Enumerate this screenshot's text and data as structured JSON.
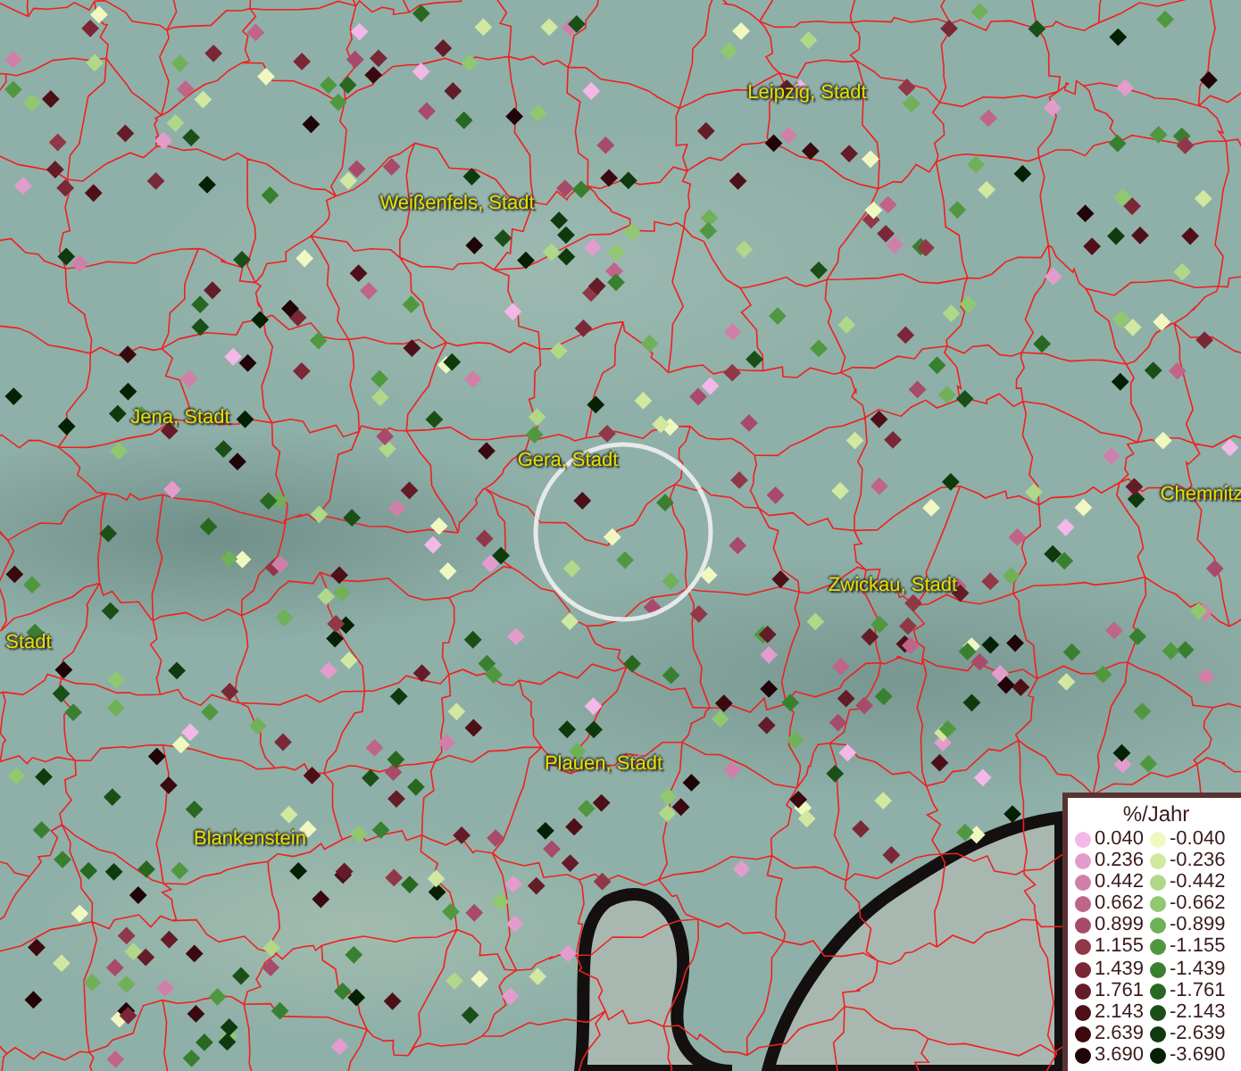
{
  "map_labels": [
    {
      "text": "Leipzig, Stadt"
    },
    {
      "text": "Weißenfels, Stadt"
    },
    {
      "text": "Jena, Stadt"
    },
    {
      "text": "Gera, Stadt"
    },
    {
      "text": "Chemnitz"
    },
    {
      "text": "Zwickau, Stadt"
    },
    {
      "text": "Stadt"
    },
    {
      "text": "Plauen, Stadt"
    },
    {
      "text": "Blankenstein"
    }
  ],
  "legend": {
    "title": "%/Jahr",
    "items": [
      {
        "label": "0.040",
        "color": "#f4b8e8"
      },
      {
        "label": "-0.040",
        "color": "#f0f8c0"
      },
      {
        "label": "0.236",
        "color": "#e39ccc"
      },
      {
        "label": "-0.236",
        "color": "#d0e8a0"
      },
      {
        "label": "0.442",
        "color": "#d080a8"
      },
      {
        "label": "-0.442",
        "color": "#b0d888"
      },
      {
        "label": "0.662",
        "color": "#c06488"
      },
      {
        "label": "-0.662",
        "color": "#90c870"
      },
      {
        "label": "0.899",
        "color": "#a84a6a"
      },
      {
        "label": "-0.899",
        "color": "#70b058"
      },
      {
        "label": "1.155",
        "color": "#903848"
      },
      {
        "label": "-1.155",
        "color": "#509840"
      },
      {
        "label": "1.439",
        "color": "#7a2838"
      },
      {
        "label": "-1.439",
        "color": "#388030"
      },
      {
        "label": "1.761",
        "color": "#641c28"
      },
      {
        "label": "-1.761",
        "color": "#286820"
      },
      {
        "label": "2.143",
        "color": "#4e1018"
      },
      {
        "label": "-2.143",
        "color": "#1a5018"
      },
      {
        "label": "2.639",
        "color": "#3a0a10"
      },
      {
        "label": "-2.639",
        "color": "#0e3a0e"
      },
      {
        "label": "3.690",
        "color": "#200408"
      },
      {
        "label": "-3.690",
        "color": "#062006"
      }
    ]
  }
}
